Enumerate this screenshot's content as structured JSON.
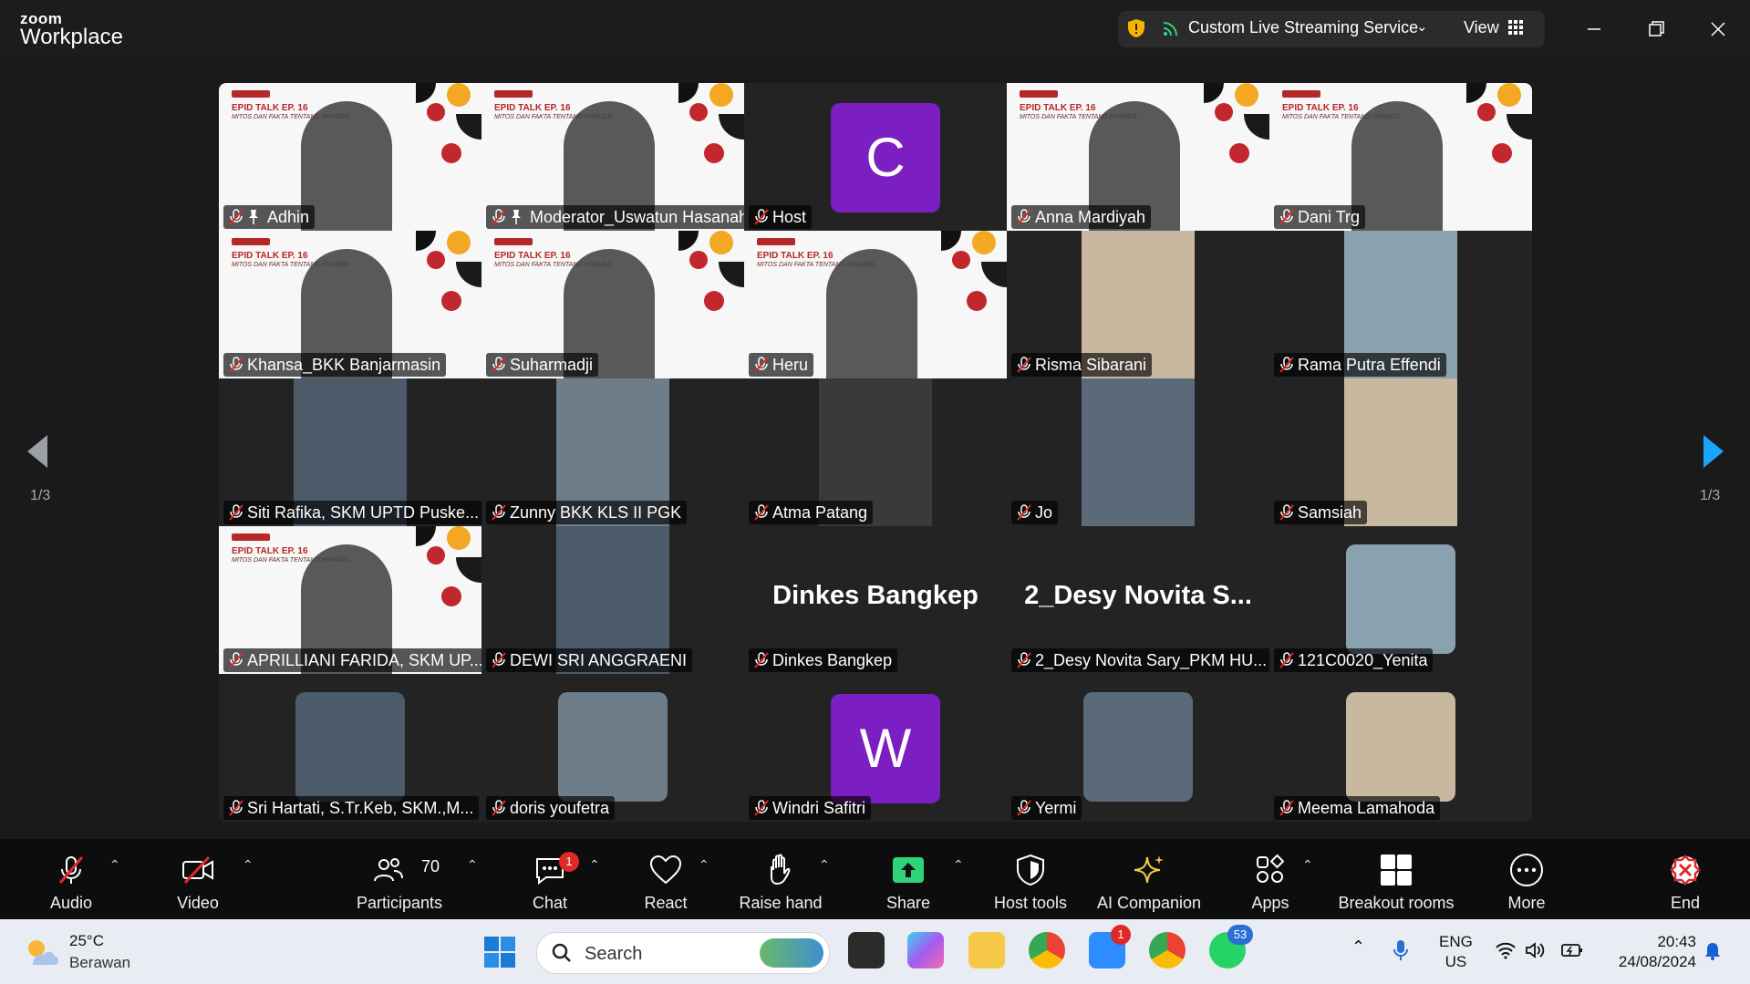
{
  "titlebar": {
    "logo_top": "zoom",
    "logo_bottom": "Workplace",
    "stream_label": "Custom Live Streaming Service",
    "view_label": "View"
  },
  "gallery": {
    "page_left": "1/3",
    "page_right": "1/3",
    "tiles": [
      {
        "name": "Adhin",
        "kind": "slide",
        "pinned": true
      },
      {
        "name": "Moderator_Uswatun Hasanah",
        "kind": "slide",
        "pinned": true,
        "speaking": true
      },
      {
        "name": "Host",
        "kind": "avatar",
        "letter": "C"
      },
      {
        "name": "Anna Mardiyah",
        "kind": "slide"
      },
      {
        "name": "Dani Trg",
        "kind": "slide"
      },
      {
        "name": "Khansa_BKK Banjarmasin",
        "kind": "slide"
      },
      {
        "name": "Suharmadji",
        "kind": "slide"
      },
      {
        "name": "Heru",
        "kind": "slide"
      },
      {
        "name": "Risma Sibarani",
        "kind": "video"
      },
      {
        "name": "Rama Putra Effendi",
        "kind": "video"
      },
      {
        "name": "Siti Rafika, SKM UPTD Puske...",
        "kind": "video"
      },
      {
        "name": "Zunny BKK KLS II PGK",
        "kind": "video"
      },
      {
        "name": "Atma Patang",
        "kind": "video"
      },
      {
        "name": "Jo",
        "kind": "video"
      },
      {
        "name": "Samsiah",
        "kind": "video"
      },
      {
        "name": "APRILLIANI FARIDA, SKM UP...",
        "kind": "slide"
      },
      {
        "name": "DEWI SRI ANGGRAENI",
        "kind": "video"
      },
      {
        "name": "Dinkes Bangkep",
        "kind": "text",
        "display": "Dinkes Bangkep"
      },
      {
        "name": "2_Desy Novita Sary_PKM HU...",
        "kind": "text",
        "display": "2_Desy  Novita  S..."
      },
      {
        "name": "121C0020_Yenita",
        "kind": "photo"
      },
      {
        "name": "Sri Hartati, S.Tr.Keb, SKM.,M...",
        "kind": "photo"
      },
      {
        "name": "doris youfetra",
        "kind": "photo"
      },
      {
        "name": "Windri Safitri",
        "kind": "avatar",
        "letter": "W"
      },
      {
        "name": "Yermi",
        "kind": "photo"
      },
      {
        "name": "Meema Lamahoda",
        "kind": "photo"
      }
    ],
    "slide_title": "EPID TALK EP. 16",
    "slide_subtitle": "MITOS DAN FAKTA TENTANG HIV/AIDS"
  },
  "toolbar": {
    "audio": "Audio",
    "video": "Video",
    "participants": "Participants",
    "participants_count": "70",
    "chat": "Chat",
    "chat_badge": "1",
    "react": "React",
    "raise_hand": "Raise hand",
    "share": "Share",
    "host_tools": "Host tools",
    "ai_companion": "AI Companion",
    "apps": "Apps",
    "breakout": "Breakout rooms",
    "more": "More",
    "end": "End"
  },
  "taskbar": {
    "temp": "25°C",
    "weather": "Berawan",
    "search": "Search",
    "lang1": "ENG",
    "lang2": "US",
    "time": "20:43",
    "date": "24/08/2024",
    "zoom_badge": "1",
    "whatsapp_badge": "53"
  },
  "colors": {
    "accent_green": "#2ed47a",
    "avatar_purple": "#7c1fc2",
    "end_red": "#e02828"
  }
}
